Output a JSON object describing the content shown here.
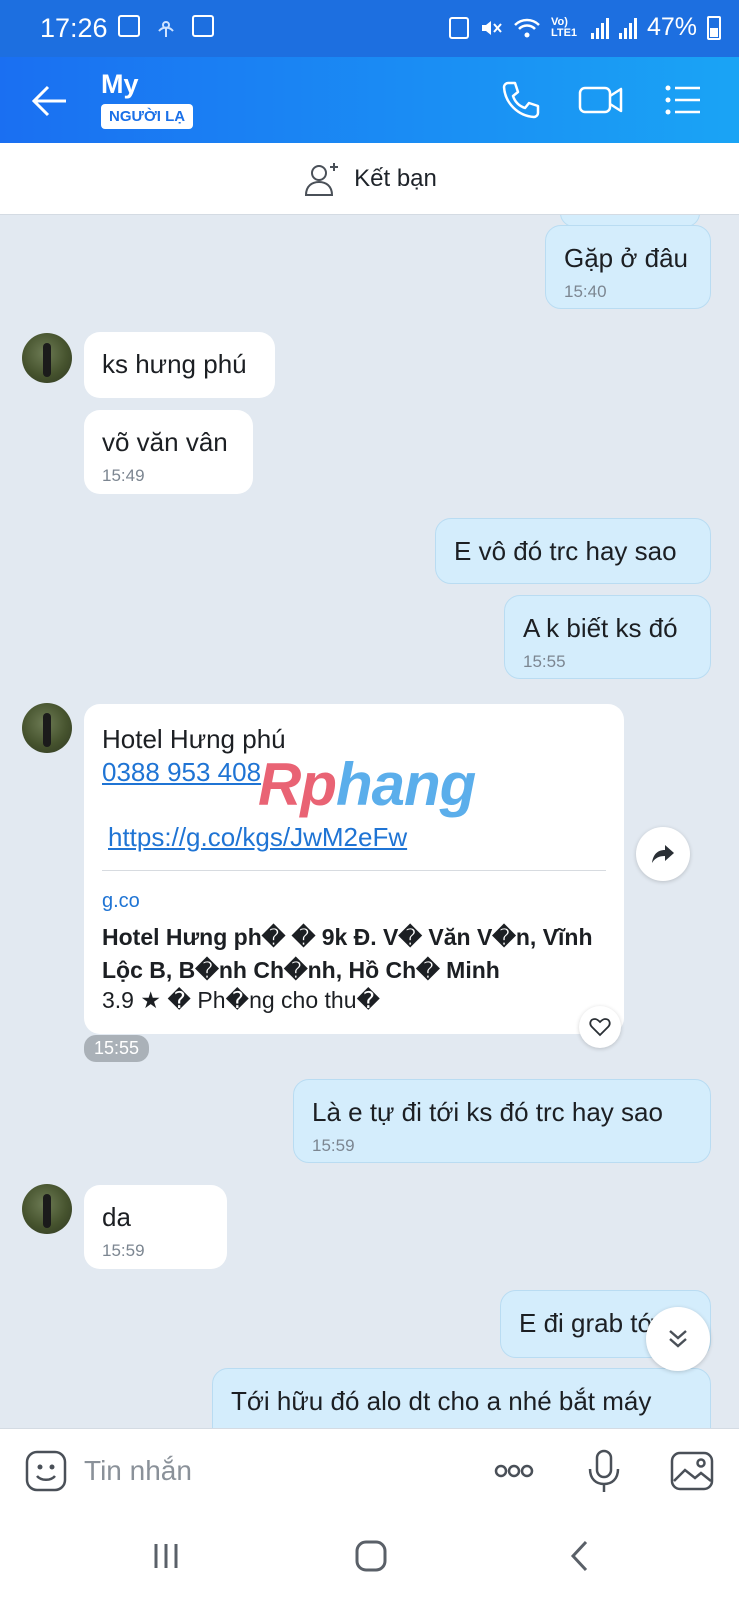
{
  "status_bar": {
    "time": "17:26",
    "battery": "47%",
    "network": "Vo) LTE1"
  },
  "header": {
    "name": "My",
    "badge": "NGƯỜI LẠ",
    "icons": [
      "back-arrow-icon",
      "phone-icon",
      "video-call-icon",
      "menu-list-icon"
    ]
  },
  "friend_bar": {
    "label": "Kết bạn"
  },
  "messages": [
    {
      "dir": "out",
      "text": "Gặp ở đâu",
      "time": "15:40"
    },
    {
      "dir": "in",
      "text": "ks hưng phú"
    },
    {
      "dir": "in",
      "text": "võ văn vân",
      "time": "15:49"
    },
    {
      "dir": "out",
      "text": "E vô đó trc hay sao"
    },
    {
      "dir": "out",
      "text": "A k biết ks đó",
      "time": "15:55"
    },
    {
      "dir": "out",
      "text": "Là e tự đi tới ks đó trc hay sao",
      "time": "15:59"
    },
    {
      "dir": "in",
      "text": "da",
      "time": "15:59"
    },
    {
      "dir": "out",
      "text": "E đi grab tớ"
    },
    {
      "dir": "out",
      "text": "Tới hữu đó alo dt cho a nhé bắt máy"
    }
  ],
  "link_card": {
    "title": "Hotel Hưng phú",
    "phone": "0388 953 408",
    "url": "https://g.co/kgs/JwM2eFw",
    "domain": "g.co",
    "preview": "Hotel Hưng ph� � 9k Đ. V� Văn V�n, Vĩnh Lộc B, B�nh Ch�nh, Hồ Ch� Minh",
    "rating": "3.9 ★ � Ph�ng cho thu�",
    "time": "15:55"
  },
  "watermark": {
    "part1": "Rp",
    "part2": "hang"
  },
  "input_bar": {
    "placeholder": "Tin nhắn"
  },
  "colors": {
    "header_start": "#1a6ff2",
    "header_end": "#1aa4f5",
    "outgoing_bubble": "#d4edfc",
    "chat_background": "#e2e9f1",
    "link": "#1f74d4"
  }
}
